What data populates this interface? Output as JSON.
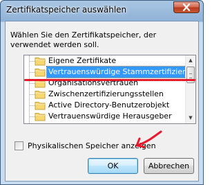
{
  "window": {
    "title": "Zertifikatspeicher auswählen"
  },
  "dialog": {
    "instruction": "Wählen Sie den Zertifikatspeicher, der verwendet werden soll.",
    "stores": [
      {
        "label": "Eigene Zertifikate",
        "selected": false
      },
      {
        "label": "Vertrauenswürdige Stammzertifizierungss",
        "selected": true
      },
      {
        "label": "Organisationsvertrauen",
        "selected": false
      },
      {
        "label": "Zwischenzertifizierungsstellen",
        "selected": false
      },
      {
        "label": "Active Directory-Benutzerobjekt",
        "selected": false
      },
      {
        "label": "Vertrauenswürdige Herausgeber",
        "selected": false
      }
    ],
    "checkbox_label": "Physikalischen Speicher anzeigen",
    "checkbox_checked": false,
    "ok_label": "OK",
    "cancel_label": "Abbrechen"
  },
  "colors": {
    "selection": "#3399ff",
    "annotation_red": "#e8192b"
  }
}
